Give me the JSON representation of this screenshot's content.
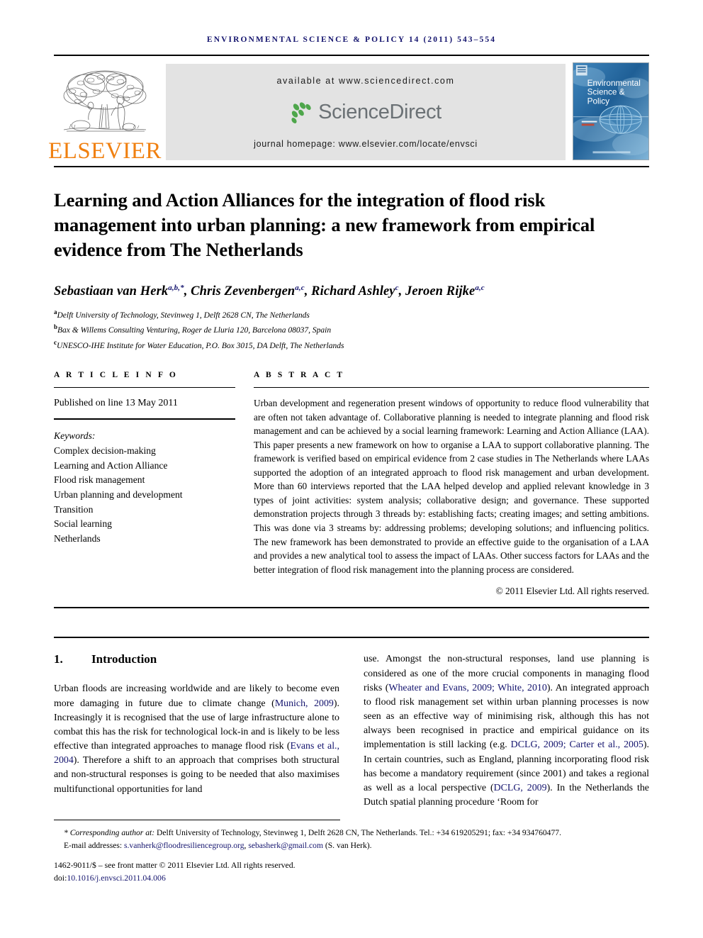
{
  "running_head": "ENVIRONMENTAL SCIENCE & POLICY 14 (2011) 543–554",
  "masthead": {
    "publisher_name": "ELSEVIER",
    "available_at": "available at www.sciencedirect.com",
    "sciencedirect_wordmark": "ScienceDirect",
    "journal_homepage": "journal homepage: www.elsevier.com/locate/envsci",
    "cover": {
      "line1": "Environmental",
      "line2": "Science &",
      "line3": "Policy"
    },
    "colors": {
      "elsevier_orange": "#f08010",
      "sciencedirect_green": "#4ea64b",
      "sciencedirect_gray": "#6b7175",
      "banner_gray": "#e3e3e3",
      "cover_blue": "#2a6ea8",
      "link_navy": "#14146e"
    }
  },
  "article": {
    "title": "Learning and Action Alliances for the integration of flood risk management into urban planning: a new framework from empirical evidence from The Netherlands",
    "authors_html": "Sebastiaan van Herk<sup>a,b,*</sup>, Chris Zevenbergen<sup>a,c</sup>, Richard Ashley<sup>c</sup>, Jeroen Rijke<sup>a,c</sup>",
    "affiliations": [
      {
        "mark": "a",
        "text": "Delft University of Technology, Stevinweg 1, Delft 2628 CN, The Netherlands"
      },
      {
        "mark": "b",
        "text": "Bax & Willems Consulting Venturing, Roger de Lluria 120, Barcelona 08037, Spain"
      },
      {
        "mark": "c",
        "text": "UNESCO-IHE Institute for Water Education, P.O. Box 3015, DA Delft, The Netherlands"
      }
    ]
  },
  "article_info": {
    "heading": "A R T I C L E   I N F O",
    "published_online": "Published on line 13 May 2011",
    "keywords_heading": "Keywords:",
    "keywords": [
      "Complex decision-making",
      "Learning and Action Alliance",
      "Flood risk management",
      "Urban planning and development",
      "Transition",
      "Social learning",
      "Netherlands"
    ]
  },
  "abstract": {
    "heading": "A B S T R A C T",
    "text": "Urban development and regeneration present windows of opportunity to reduce flood vulnerability that are often not taken advantage of. Collaborative planning is needed to integrate planning and flood risk management and can be achieved by a social learning framework: Learning and Action Alliance (LAA). This paper presents a new framework on how to organise a LAA to support collaborative planning. The framework is verified based on empirical evidence from 2 case studies in The Netherlands where LAAs supported the adoption of an integrated approach to flood risk management and urban development. More than 60 interviews reported that the LAA helped develop and applied relevant knowledge in 3 types of joint activities: system analysis; collaborative design; and governance. These supported demonstration projects through 3 threads by: establishing facts; creating images; and setting ambitions. This was done via 3 streams by: addressing problems; developing solutions; and influencing politics. The new framework has been demonstrated to provide an effective guide to the organisation of a LAA and provides a new analytical tool to assess the impact of LAAs. Other success factors for LAAs and the better integration of flood risk management into the planning process are considered.",
    "copyright": "© 2011 Elsevier Ltd. All rights reserved."
  },
  "introduction": {
    "number": "1.",
    "title": "Introduction",
    "left_column_html": "Urban floods are increasing worldwide and are likely to become even more damaging in future due to climate change (<span class=\"cite\">Munich, 2009</span>). Increasingly it is recognised that the use of large infrastructure alone to combat this has the risk for technological lock-in and is likely to be less effective than integrated approaches to manage flood risk (<span class=\"cite\">Evans et al., 2004</span>). Therefore a shift to an approach that comprises both structural and non-structural responses is going to be needed that also maximises multifunctional opportunities for land",
    "right_column_html": "use. Amongst the non-structural responses, land use planning is considered as one of the more crucial components in managing flood risks (<span class=\"cite\">Wheater and Evans, 2009; White, 2010</span>). An integrated approach to flood risk management set within urban planning processes is now seen as an effective way of minimising risk, although this has not always been recognised in practice and empirical guidance on its implementation is still lacking (e.g. <span class=\"cite\">DCLG, 2009; Carter et al., 2005</span>). In certain countries, such as England, planning incorporating flood risk has become a mandatory requirement (since 2001) and takes a regional as well as a local perspective (<span class=\"cite\">DCLG, 2009</span>). In the Netherlands the Dutch spatial planning procedure ‘Room for"
  },
  "footnotes": {
    "corresponding_html": "<span class=\"fn-star\">* Corresponding author at:</span> Delft University of Technology, Stevinweg 1, Delft 2628 CN, The Netherlands. Tel.: +34 619205291; fax: +34 934760477.",
    "email_html": "E-mail addresses: <span class=\"fn-link\">s.vanherk@floodresiliencegroup.org</span>, <span class=\"fn-link\">sebasherk@gmail.com</span> (S. van Herk).",
    "front_matter": "1462-9011/$ – see front matter © 2011 Elsevier Ltd. All rights reserved.",
    "doi_label": "doi:",
    "doi_value": "10.1016/j.envsci.2011.04.006"
  }
}
